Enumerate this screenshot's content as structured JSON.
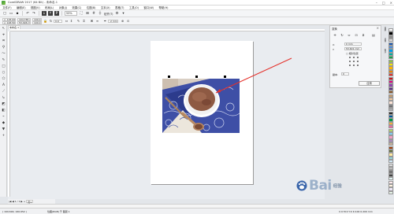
{
  "app": {
    "title": "CorelDRAW 2017 (64 Bit) - 未命名-1"
  },
  "window_controls": [
    "–",
    "□",
    "×"
  ],
  "menu": [
    "文件(F)",
    "编辑(E)",
    "视图(V)",
    "布局(L)",
    "对象(J)",
    "效果(C)",
    "位图(B)",
    "文本(X)",
    "表格(T)",
    "工具(O)",
    "窗口(W)",
    "帮助(H)"
  ],
  "toolbar": {
    "zoom": "53%",
    "snap_label": "贴齐(T)"
  },
  "propbar": {
    "x": "x: 105.000 mm",
    "y": "y: 148.500 mm",
    "w": "104.785 mm",
    "h": "53.496 mm",
    "sx": "100.0",
    "sy": "100.0",
    "angle": "0.0",
    "outline": ".2 mm"
  },
  "document_tab": "未命名-1",
  "docker": {
    "title": "变换",
    "x_value": "0 mm",
    "y_value": "53.601 mm",
    "x_label": "X:",
    "y_label": "Y:",
    "relative_label": "□ 相对位置",
    "copies_label": "副本:",
    "copies_value": "0",
    "apply": "应用"
  },
  "side_tabs": [
    "变换",
    "对象",
    "提示"
  ],
  "page_nav": {
    "count": "1 / 1",
    "page_label": "页1"
  },
  "status": {
    "coords": "( 199.690, 160.652 )",
    "selection": "位图(RGB) 于 图层 1",
    "fill_info": "C:0 M:0 Y:0 K:100 0.200 mm"
  },
  "watermark": {
    "brand": "Bai",
    "suffix": "经验"
  },
  "colors": {
    "accent_red": "#e5312b",
    "palette": [
      "#ffffff",
      "#000000",
      "#8c8c8c",
      "#d9d9d9",
      "#1e5bb5",
      "#4a90e2",
      "#00a0e9",
      "#00b1a3",
      "#19a34a",
      "#8cc63f",
      "#f7e400",
      "#ffb400",
      "#f08300",
      "#e5312b",
      "#c8161d",
      "#e4007f",
      "#8e44ad",
      "#5b2c83",
      "#8b5a2b",
      "#c49a6c",
      "#f1c9a0",
      "#fbe3d6",
      "#6d6e71",
      "#a7a9ac",
      "#2b2b2b",
      "#00599d",
      "#009944",
      "#f6ad3c",
      "#ea68a2",
      "#b3d465",
      "#7ecef4",
      "#f19ec2",
      "#aa89bd",
      "#c7b299",
      "#a1410d",
      "#606c38",
      "#ffe9a0",
      "#94d6da",
      "#cfe6f5",
      "#dcdcdc",
      "#bdbdbd",
      "#757575",
      "#424242",
      "#e0f2f1",
      "#ffebee",
      "#fff3e0",
      "#ede7f6",
      "#e8f5e9"
    ]
  }
}
